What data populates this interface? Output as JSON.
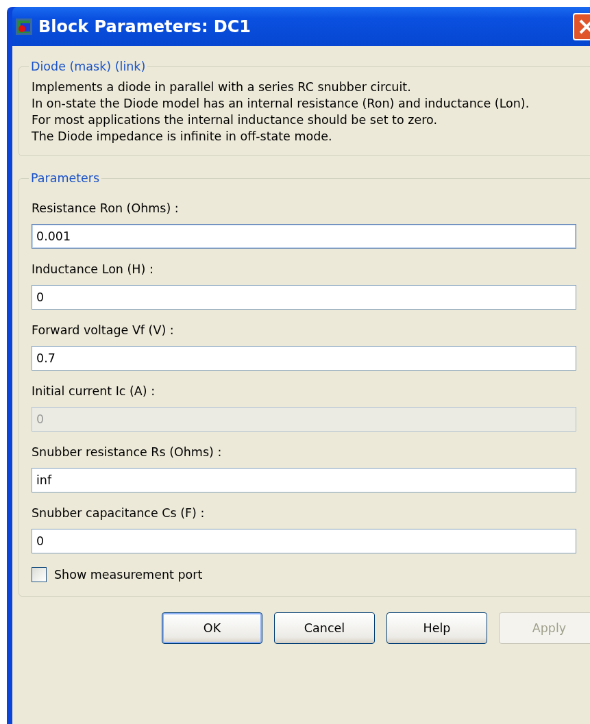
{
  "window": {
    "title": "Block Parameters: DC1"
  },
  "description": {
    "legend": "Diode (mask) (link)",
    "lines": [
      "Implements a diode in parallel with a series RC snubber circuit.",
      "In on-state the Diode model has an internal resistance (Ron) and inductance (Lon).",
      "For most applications the internal inductance should be set to zero.",
      "The Diode impedance is infinite in off-state mode."
    ]
  },
  "parameters": {
    "legend": "Parameters",
    "fields": [
      {
        "label": "Resistance Ron (Ohms) :",
        "value": "0.001",
        "disabled": false,
        "focused": true
      },
      {
        "label": "Inductance Lon (H) :",
        "value": "0",
        "disabled": false,
        "focused": false
      },
      {
        "label": "Forward voltage Vf (V) :",
        "value": "0.7",
        "disabled": false,
        "focused": false
      },
      {
        "label": "Initial current Ic (A) :",
        "value": "0",
        "disabled": true,
        "focused": false
      },
      {
        "label": "Snubber resistance Rs (Ohms) :",
        "value": "inf",
        "disabled": false,
        "focused": false
      },
      {
        "label": "Snubber capacitance Cs (F) :",
        "value": "0",
        "disabled": false,
        "focused": false
      }
    ],
    "checkbox": {
      "label": "Show measurement port",
      "checked": false
    }
  },
  "buttons": [
    {
      "label": "OK",
      "disabled": false,
      "default": true
    },
    {
      "label": "Cancel",
      "disabled": false,
      "default": false
    },
    {
      "label": "Help",
      "disabled": false,
      "default": false
    },
    {
      "label": "Apply",
      "disabled": true,
      "default": false
    }
  ]
}
